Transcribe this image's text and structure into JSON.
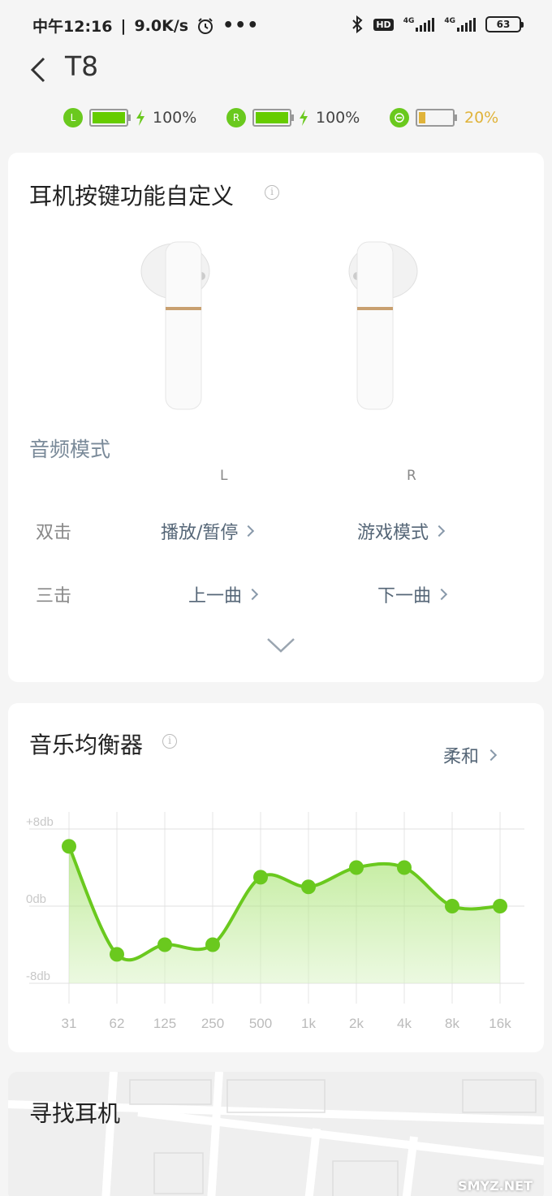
{
  "status_bar": {
    "time": "中午12:16",
    "speed": "9.0K/s",
    "hd": "HD",
    "net1": "4G",
    "net2": "4G",
    "battery": "63"
  },
  "header": {
    "title": "T8"
  },
  "batteries": {
    "left": {
      "letter": "L",
      "percent": "100%",
      "level": 1.0
    },
    "right": {
      "letter": "R",
      "percent": "100%",
      "level": 1.0
    },
    "case": {
      "percent": "20%",
      "level": 0.2
    }
  },
  "buttons_card": {
    "title": "耳机按键功能自定义",
    "info_glyph": "i",
    "mode_title": "音频模式",
    "col_left": "L",
    "col_right": "R",
    "rows": [
      {
        "label": "双击",
        "left": "播放/暂停",
        "right": "游戏模式"
      },
      {
        "label": "三击",
        "left": "上一曲",
        "right": "下一曲"
      }
    ]
  },
  "eq_card": {
    "title": "音乐均衡器",
    "info_glyph": "i",
    "preset": "柔和"
  },
  "find_card": {
    "title": "寻找耳机"
  },
  "watermark": "SMYZ.NET",
  "colors": {
    "accent": "#66cc00",
    "low_battery": "#e0b33a",
    "eq_line": "#6ac91e"
  },
  "chart_data": {
    "type": "line",
    "categories": [
      "31",
      "62",
      "125",
      "250",
      "500",
      "1k",
      "2k",
      "4k",
      "8k",
      "16k"
    ],
    "series": [
      {
        "values": [
          6.2,
          -5,
          -4,
          -4,
          3,
          2,
          4,
          4,
          0,
          0
        ]
      }
    ],
    "y_tick_labels": [
      "+8db",
      "0db",
      "-8db"
    ],
    "ylim": [
      -8,
      8
    ],
    "grid": true
  }
}
